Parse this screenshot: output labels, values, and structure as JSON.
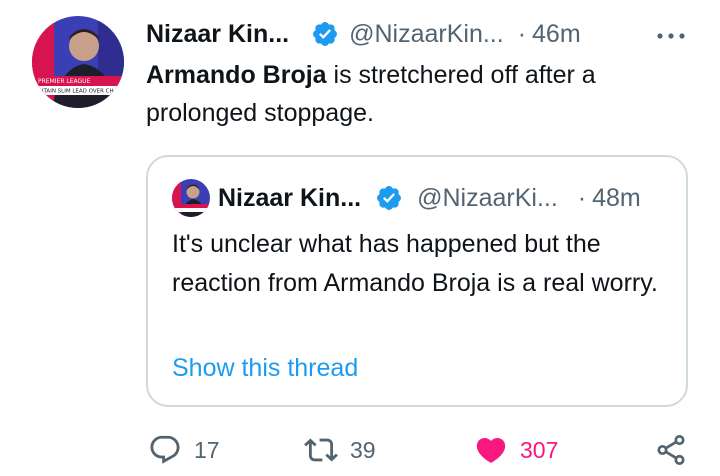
{
  "tweet": {
    "author_name": "Nizaar Kin...",
    "author_handle": "@NizaarKin...",
    "separator": "·",
    "time": "46m",
    "text_bold": "Armando Broja",
    "text_rest": " is stretchered off after a prolonged stoppage.",
    "avatar_banner_lines": [
      "PREMIER LEAGUE",
      "AINTAIN SLIM LEAD OVER CH"
    ]
  },
  "quoted": {
    "author_name": "Nizaar Kin...",
    "author_handle": "@NizaarKi...",
    "separator": "·",
    "time": "48m",
    "text": "It's unclear what has happened but the reaction from Armando Broja is a real worry.",
    "link": "Show this thread"
  },
  "actions": {
    "reply_count": "17",
    "retweet_count": "39",
    "like_count": "307"
  },
  "icons": {
    "verified": "verified-badge-icon",
    "more": "more-options-icon",
    "reply": "reply-icon",
    "retweet": "retweet-icon",
    "like": "heart-icon",
    "share": "share-icon"
  },
  "colors": {
    "accent": "#1d9bf0",
    "like": "#f91880",
    "secondary_text": "#536471",
    "border": "#cfd9de"
  }
}
